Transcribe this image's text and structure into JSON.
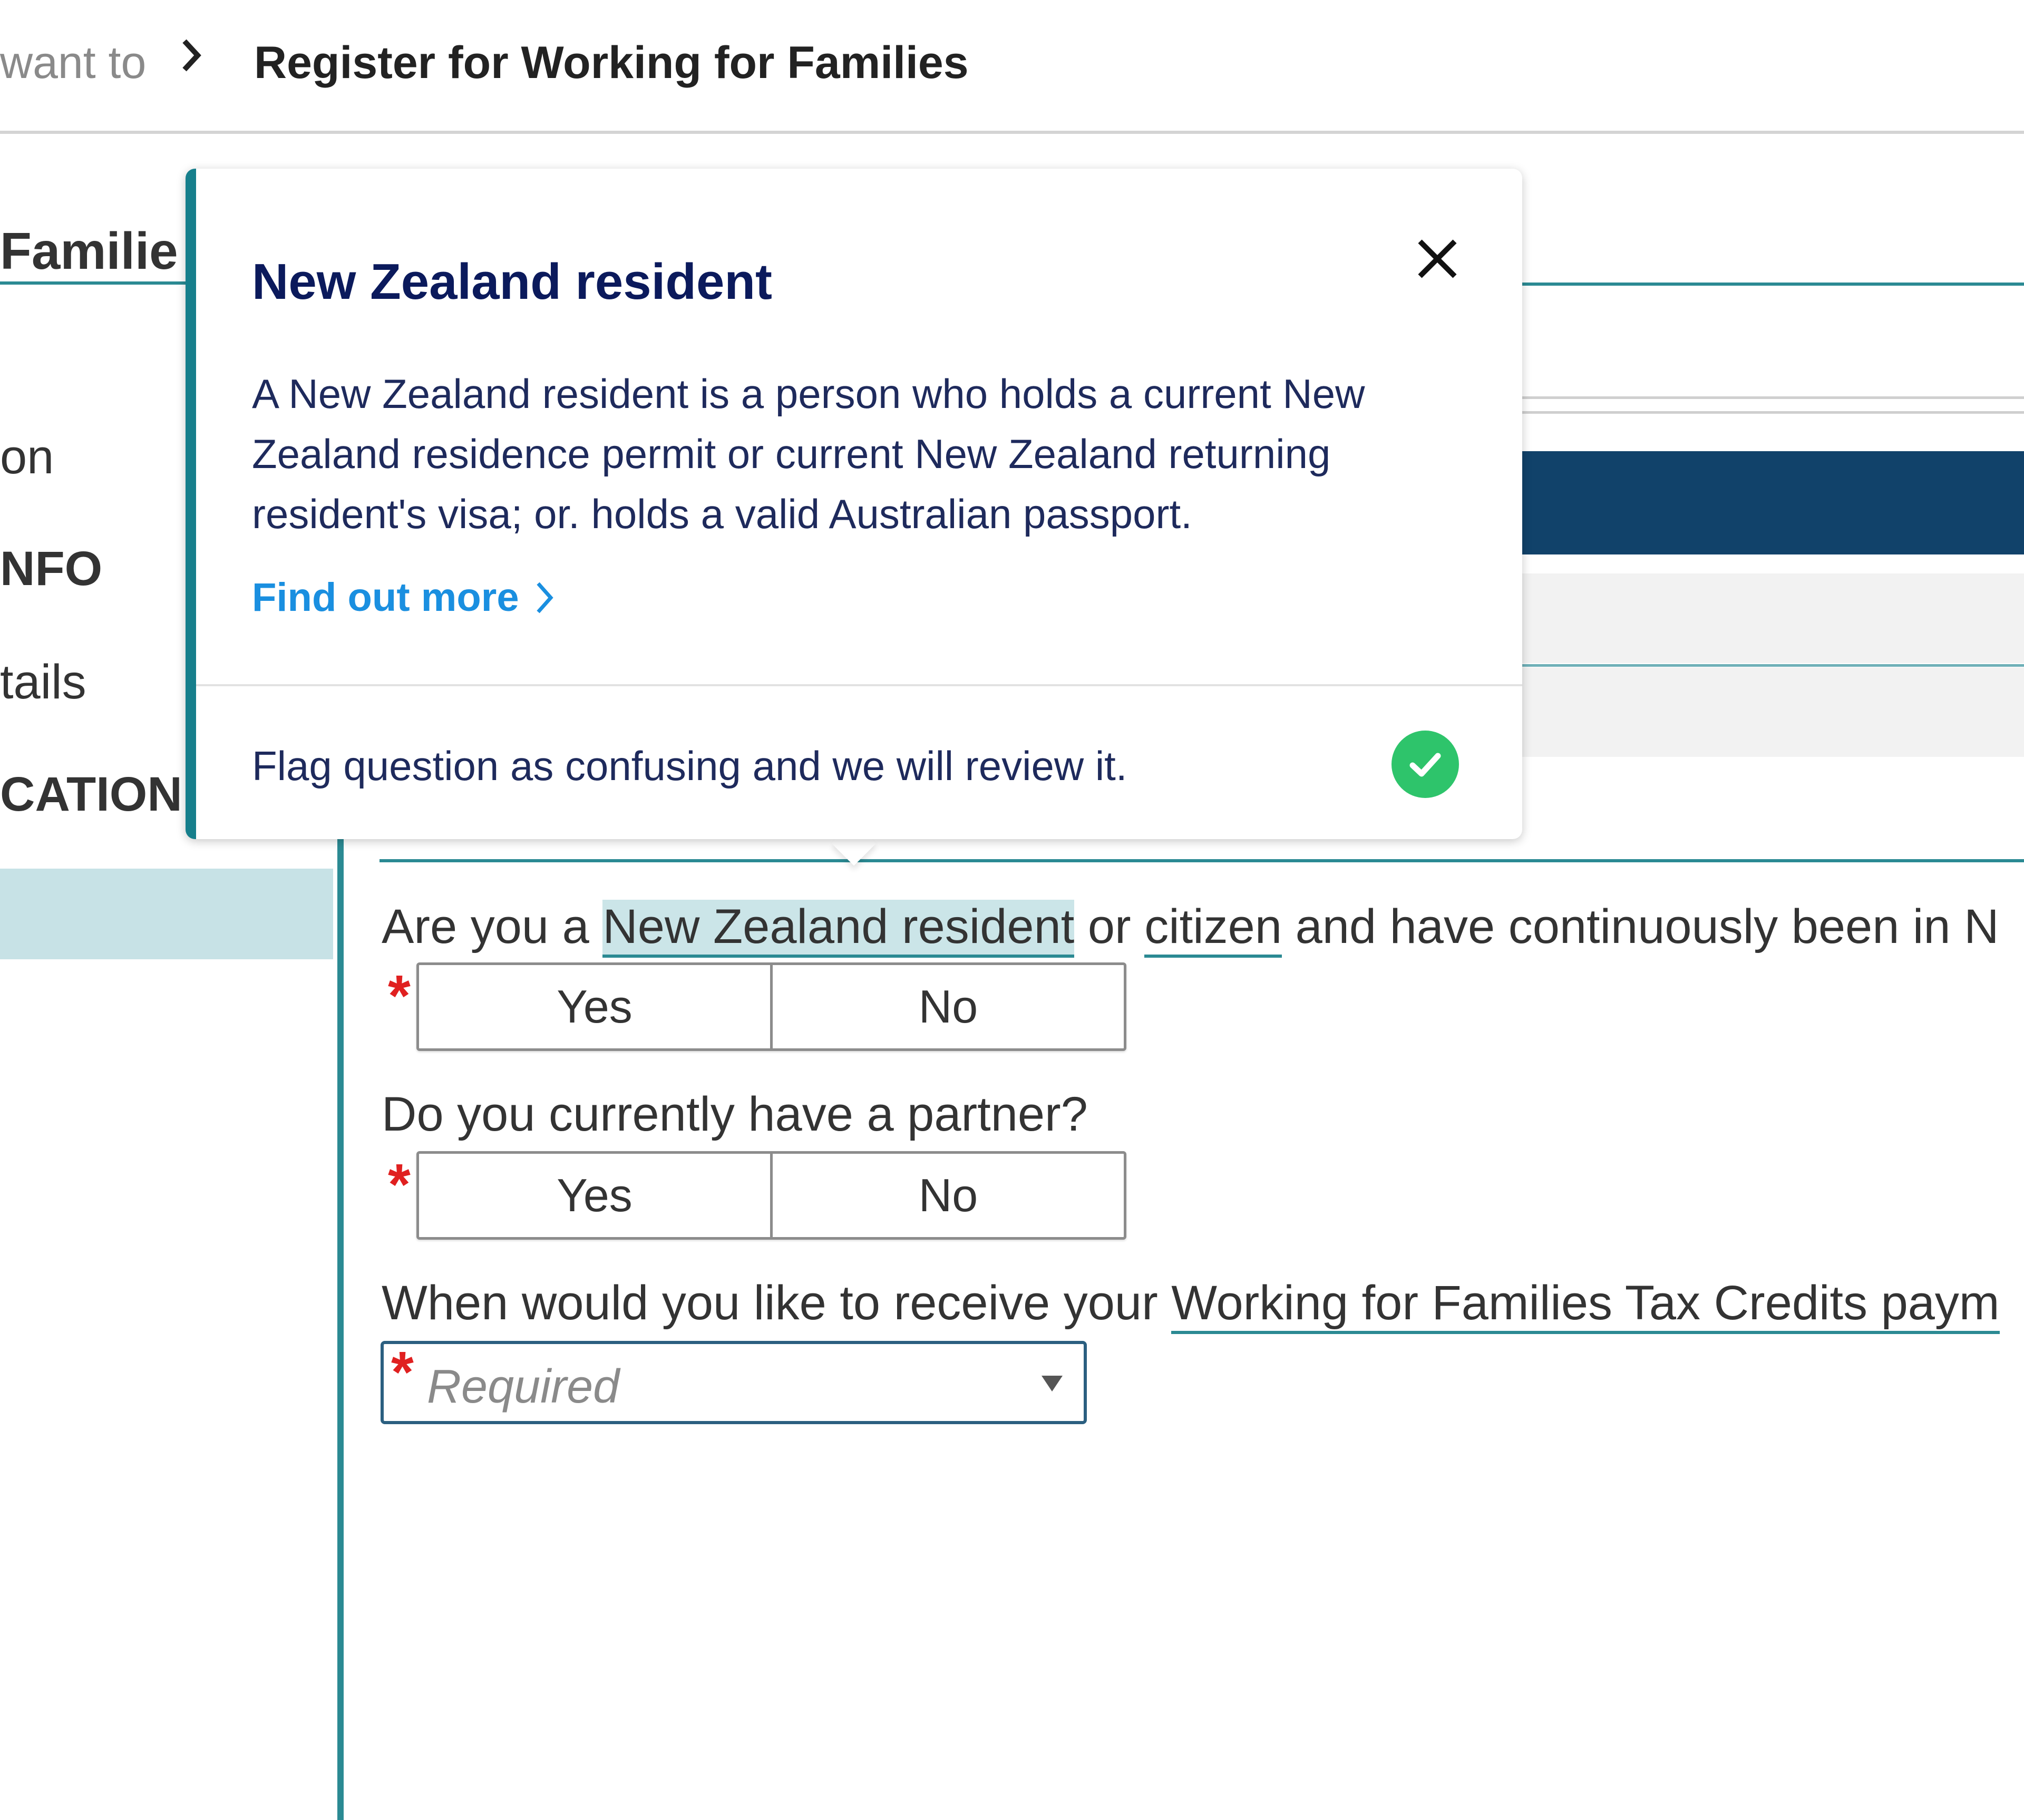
{
  "breadcrumb": {
    "previous": "want to",
    "current": "Register for Working for Families"
  },
  "left_nav": {
    "title": "Familie",
    "items": [
      {
        "label": "on",
        "bold": false
      },
      {
        "label": "NFO",
        "bold": true
      },
      {
        "label": "tails",
        "bold": false
      },
      {
        "label": "CATION",
        "bold": true
      }
    ]
  },
  "questions": {
    "q1": {
      "prefix": "Are you a",
      "term1": "New Zealand resident",
      "middle": "or",
      "term2": "citizen",
      "suffix": "and have continuously been in N",
      "yes": "Yes",
      "no": "No"
    },
    "q2": {
      "text": "Do you currently have a partner?",
      "yes": "Yes",
      "no": "No"
    },
    "q3": {
      "prefix": "When would you like to receive your",
      "term": "Working for Families Tax Credits paym",
      "placeholder": "Required"
    },
    "required_marker": "*"
  },
  "popover": {
    "title": "New Zealand resident",
    "body": "A New Zealand resident is a person who holds a current New Zealand residence permit or current New Zealand returning resident's visa; or. holds a valid Australian passport.",
    "link": "Find out more",
    "flag_text": "Flag question as confusing and we will review it."
  },
  "icons": {
    "breadcrumb_separator": "chevron-right-icon",
    "close": "close-icon",
    "link_chevron": "chevron-right-icon",
    "flag_check": "check-circle-icon",
    "select_arrow": "caret-down-icon"
  },
  "colors": {
    "teal_accent": "#2b8a93",
    "popover_border": "#167f8c",
    "popover_title": "#0b1a5c",
    "link_blue": "#1a8fe0",
    "check_green": "#2ec46b",
    "navy_bar": "#11426a",
    "required_red": "#e02020"
  }
}
